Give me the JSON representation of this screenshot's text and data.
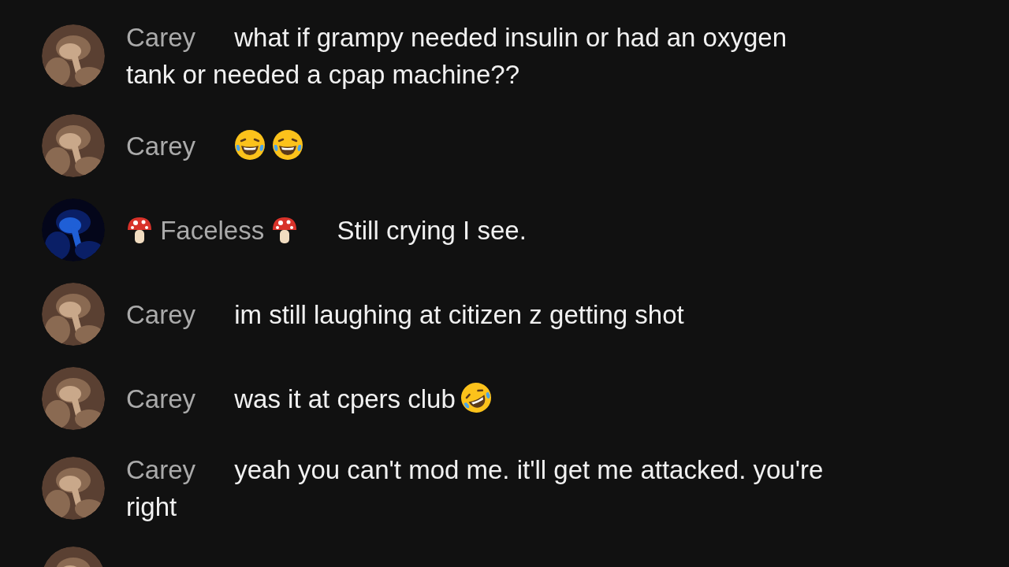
{
  "chat_messages": [
    {
      "avatar": {
        "kind": "photo-brown"
      },
      "author": "Carey",
      "parts": [
        {
          "kind": "text",
          "lines": [
            "what if grampy needed insulin or had an oxygen",
            "tank or needed a cpap machine??"
          ]
        }
      ]
    },
    {
      "avatar": {
        "kind": "photo-brown"
      },
      "author": "Carey",
      "parts": [
        {
          "kind": "tears-of-joy"
        },
        {
          "kind": "tears-of-joy"
        }
      ]
    },
    {
      "avatar": {
        "kind": "photo-blue"
      },
      "author": "Faceless",
      "badge": {
        "kind": "mushroom"
      },
      "parts": [
        {
          "kind": "text",
          "lines": [
            "Still crying I see."
          ]
        }
      ]
    },
    {
      "avatar": {
        "kind": "photo-brown"
      },
      "author": "Carey",
      "parts": [
        {
          "kind": "text",
          "lines": [
            "im still laughing at citizen z getting shot"
          ]
        }
      ]
    },
    {
      "avatar": {
        "kind": "photo-brown"
      },
      "author": "Carey",
      "parts": [
        {
          "kind": "text",
          "lines": [
            "was it at cpers club"
          ]
        },
        {
          "kind": "rofl"
        }
      ]
    },
    {
      "avatar": {
        "kind": "photo-brown"
      },
      "author": "Carey",
      "parts": [
        {
          "kind": "text",
          "lines": [
            "yeah you can't mod me. it'll get me attacked. you're",
            "right"
          ]
        }
      ]
    },
    {
      "avatar": {
        "kind": "photo-brown"
      }
    }
  ]
}
